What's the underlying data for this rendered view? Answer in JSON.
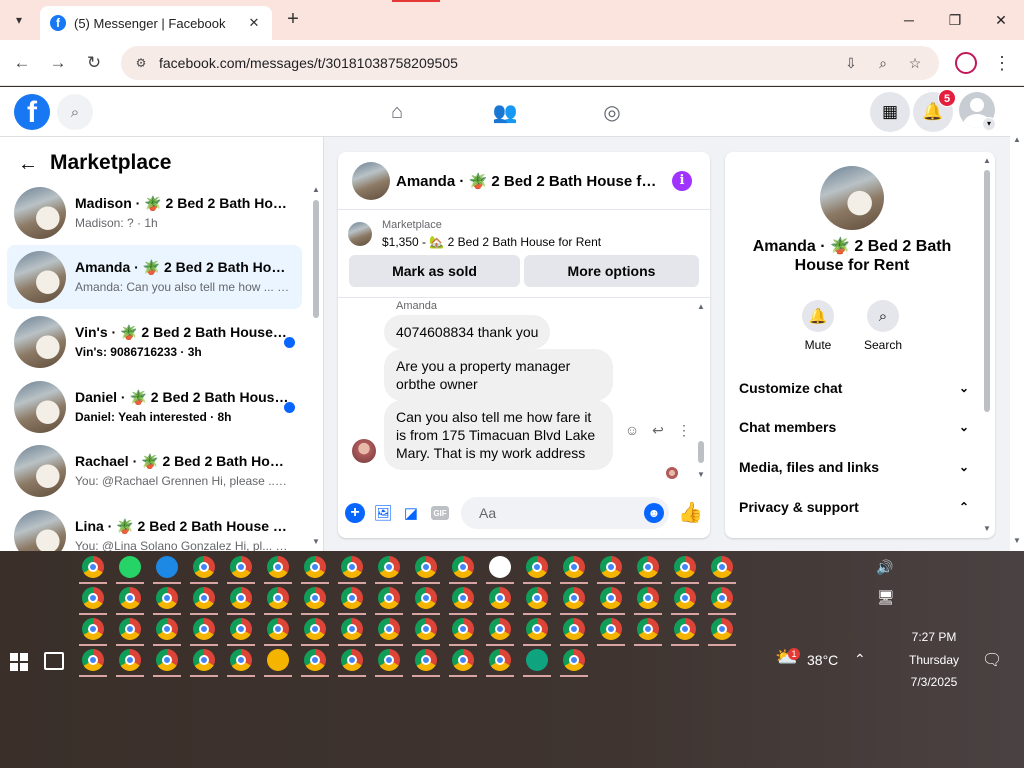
{
  "browser": {
    "tab_title": "(5) Messenger | Facebook",
    "favicon": "f",
    "url": "facebook.com/messages/t/30181038758209505",
    "new_tab": "+",
    "dropdown": "⌄"
  },
  "fb": {
    "logo": "f",
    "notification_count": "5"
  },
  "left": {
    "title": "Marketplace",
    "conversations": [
      {
        "name": "Madison · 🪴 2 Bed 2 Bath House for Rent",
        "preview": "Madison: ? · 1h",
        "unread": false
      },
      {
        "name": "Amanda · 🪴 2 Bed 2 Bath House for Rent",
        "preview": "Amanda: Can you also tell me how ... · 3h",
        "unread": false
      },
      {
        "name": "Vin's · 🪴 2 Bed 2 Bath House for Rent",
        "preview": "Vin's: 9086716233 · 3h",
        "unread": true
      },
      {
        "name": "Daniel · 🪴 2 Bed 2 Bath House for Rent",
        "preview": "Daniel: Yeah interested · 8h",
        "unread": true
      },
      {
        "name": "Rachael · 🪴 2 Bed 2 Bath House for Rent",
        "preview": "You: @Rachael Grennen Hi, please ... · 8h",
        "unread": false
      },
      {
        "name": "Lina · 🪴 2 Bed 2 Bath House for Rent",
        "preview": "You: @Lina Solano Gonzalez Hi, pl... · 12h",
        "unread": false
      }
    ]
  },
  "chat": {
    "header_name": "Amanda · 🪴 2 Bed 2 Bath House for Rent",
    "listing_label": "Marketplace",
    "listing_sub": "$1,350 - 🏡 2 Bed 2 Bath House for Rent",
    "mark_sold": "Mark as sold",
    "more_options": "More options",
    "sender": "Amanda",
    "messages": [
      "4074608834 thank you",
      "Are you a property manager orbthe owner",
      "Can you also tell me how fare it is from 175 Timacuan Blvd Lake Mary. That is my work address"
    ],
    "composer_placeholder": "Aa",
    "gif": "GIF"
  },
  "details": {
    "name": "Amanda · 🪴 2 Bed 2 Bath House for Rent",
    "mute": "Mute",
    "search": "Search",
    "sections": [
      "Customize chat",
      "Chat members",
      "Media, files and links",
      "Privacy & support"
    ]
  },
  "taskbar": {
    "weather": "38°C",
    "weather_badge": "1",
    "time": "7:27 PM",
    "day": "Thursday",
    "date": "7/3/2025"
  }
}
